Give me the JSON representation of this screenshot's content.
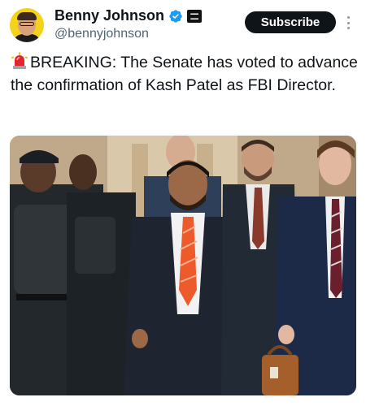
{
  "author": {
    "display_name": "Benny Johnson",
    "handle": "@bennyjohnson",
    "verified_icon": "verified-badge-icon",
    "affiliate_badge_icon": "affiliate-badge-icon"
  },
  "actions": {
    "subscribe_label": "Subscribe",
    "more_icon": "more-vertical-icon"
  },
  "tweet": {
    "emoji_icon": "siren-emoji-icon",
    "text": "BREAKING: The Senate has voted to advance the confirmation of Kash Patel as FBI Director."
  },
  "media": {
    "type": "photo"
  },
  "colors": {
    "subscribe_bg": "#0f1419",
    "verified_blue": "#1d9bf0",
    "handle_gray": "#536471"
  }
}
